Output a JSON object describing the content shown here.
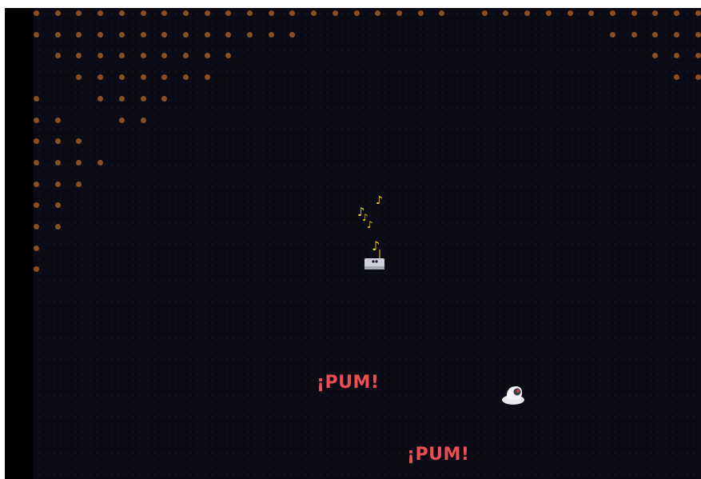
{
  "colors": {
    "frame": "#000000",
    "background": "#0b0b16",
    "pellet": "#8a4f22",
    "music_note": "#e8d21a",
    "sfx_text": "#ec4e54"
  },
  "icons": {
    "jukebox": "radio-jukebox-icon",
    "player": "robot-vacuum-icon",
    "notes": "music-note-icon",
    "pellets": "pellet-dot-icon"
  },
  "effects": {
    "pum_1": "¡PUM!",
    "pum_2": "¡PUM!"
  },
  "music_notes": {
    "glyph": "♪"
  },
  "pellet_pattern": {
    "rows": [
      [
        1,
        1,
        1,
        1,
        1,
        1,
        1,
        1,
        1,
        1,
        1,
        1,
        1,
        1,
        1,
        1,
        1,
        1,
        1,
        1,
        0,
        1,
        1,
        1,
        1,
        1,
        1,
        1,
        1,
        1,
        1,
        1
      ],
      [
        1,
        1,
        1,
        1,
        1,
        1,
        1,
        1,
        1,
        1,
        1,
        1,
        1,
        0,
        0,
        0,
        0,
        0,
        0,
        0,
        0,
        0,
        0,
        0,
        0,
        0,
        0,
        1,
        1,
        1,
        1,
        1
      ],
      [
        0,
        1,
        1,
        1,
        1,
        1,
        1,
        1,
        1,
        1,
        0,
        0,
        0,
        0,
        0,
        0,
        0,
        0,
        0,
        0,
        0,
        0,
        0,
        0,
        0,
        0,
        0,
        0,
        0,
        1,
        1,
        1
      ],
      [
        0,
        0,
        1,
        1,
        1,
        1,
        1,
        1,
        1,
        0,
        0,
        0,
        0,
        0,
        0,
        0,
        0,
        0,
        0,
        0,
        0,
        0,
        0,
        0,
        0,
        0,
        0,
        0,
        0,
        0,
        1,
        1
      ],
      [
        1,
        0,
        0,
        1,
        1,
        1,
        1,
        0,
        0,
        0,
        0,
        0,
        0,
        0,
        0,
        0,
        0,
        0,
        0,
        0,
        0,
        0,
        0,
        0,
        0,
        0,
        0,
        0,
        0,
        0,
        0,
        0
      ],
      [
        1,
        1,
        0,
        0,
        1,
        1,
        0,
        0,
        0,
        0,
        0,
        0,
        0,
        0,
        0,
        0,
        0,
        0,
        0,
        0,
        0,
        0,
        0,
        0,
        0,
        0,
        0,
        0,
        0,
        0,
        0,
        0
      ],
      [
        1,
        1,
        1,
        0,
        0,
        0,
        0,
        0,
        0,
        0,
        0,
        0,
        0,
        0,
        0,
        0,
        0,
        0,
        0,
        0,
        0,
        0,
        0,
        0,
        0,
        0,
        0,
        0,
        0,
        0,
        0,
        0
      ],
      [
        1,
        1,
        1,
        1,
        0,
        0,
        0,
        0,
        0,
        0,
        0,
        0,
        0,
        0,
        0,
        0,
        0,
        0,
        0,
        0,
        0,
        0,
        0,
        0,
        0,
        0,
        0,
        0,
        0,
        0,
        0,
        0
      ],
      [
        1,
        1,
        1,
        0,
        0,
        0,
        0,
        0,
        0,
        0,
        0,
        0,
        0,
        0,
        0,
        0,
        0,
        0,
        0,
        0,
        0,
        0,
        0,
        0,
        0,
        0,
        0,
        0,
        0,
        0,
        0,
        0
      ],
      [
        1,
        1,
        0,
        0,
        0,
        0,
        0,
        0,
        0,
        0,
        0,
        0,
        0,
        0,
        0,
        0,
        0,
        0,
        0,
        0,
        0,
        0,
        0,
        0,
        0,
        0,
        0,
        0,
        0,
        0,
        0,
        0
      ],
      [
        1,
        1,
        0,
        0,
        0,
        0,
        0,
        0,
        0,
        0,
        0,
        0,
        0,
        0,
        0,
        0,
        0,
        0,
        0,
        0,
        0,
        0,
        0,
        0,
        0,
        0,
        0,
        0,
        0,
        0,
        0,
        0
      ],
      [
        1,
        0,
        0,
        0,
        0,
        0,
        0,
        0,
        0,
        0,
        0,
        0,
        0,
        0,
        0,
        0,
        0,
        0,
        0,
        0,
        0,
        0,
        0,
        0,
        0,
        0,
        0,
        0,
        0,
        0,
        0,
        0
      ],
      [
        1,
        0,
        0,
        0,
        0,
        0,
        0,
        0,
        0,
        0,
        0,
        0,
        0,
        0,
        0,
        0,
        0,
        0,
        0,
        0,
        0,
        0,
        0,
        0,
        0,
        0,
        0,
        0,
        0,
        0,
        0,
        0
      ]
    ]
  }
}
